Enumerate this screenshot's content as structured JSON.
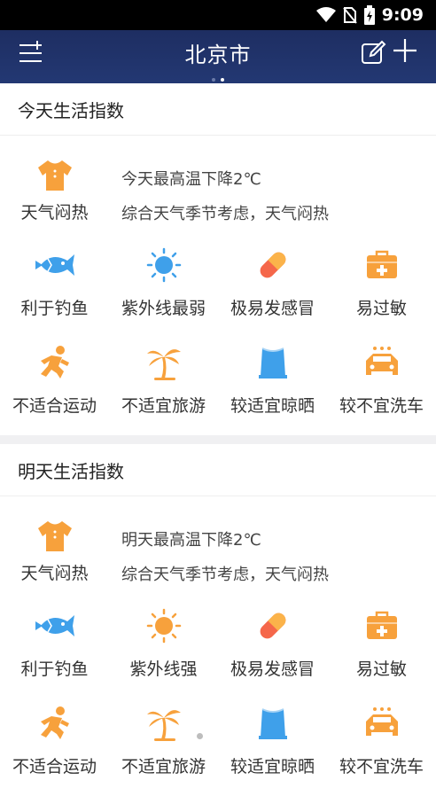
{
  "status": {
    "time": "9:09"
  },
  "header": {
    "title": "北京市"
  },
  "today": {
    "heading": "今天生活指数",
    "summary_label": "天气闷热",
    "line1": "今天最高温下降2℃",
    "line2": "综合天气季节考虑，天气闷热",
    "row1": [
      "利于钓鱼",
      "紫外线最弱",
      "极易发感冒",
      "易过敏"
    ],
    "row2": [
      "不适合运动",
      "不适宜旅游",
      "较适宜晾晒",
      "较不宜洗车"
    ]
  },
  "tomorrow": {
    "heading": "明天生活指数",
    "summary_label": "天气闷热",
    "line1": "明天最高温下降2℃",
    "line2": "综合天气季节考虑，天气闷热",
    "row1": [
      "利于钓鱼",
      "紫外线强",
      "极易发感冒",
      "易过敏"
    ],
    "row2": [
      "不适合运动",
      "不适宜旅游",
      "较适宜晾晒",
      "较不宜洗车"
    ]
  },
  "icons": [
    "shirt-icon",
    "fish-icon",
    "sun-icon",
    "pill-icon",
    "medkit-icon",
    "runner-icon",
    "palm-tree-icon",
    "factory-icon",
    "car-wash-icon"
  ],
  "colors": {
    "topbar": "#233873",
    "accent_orange": "#f7a13c",
    "accent_blue": "#3fa0ea"
  }
}
